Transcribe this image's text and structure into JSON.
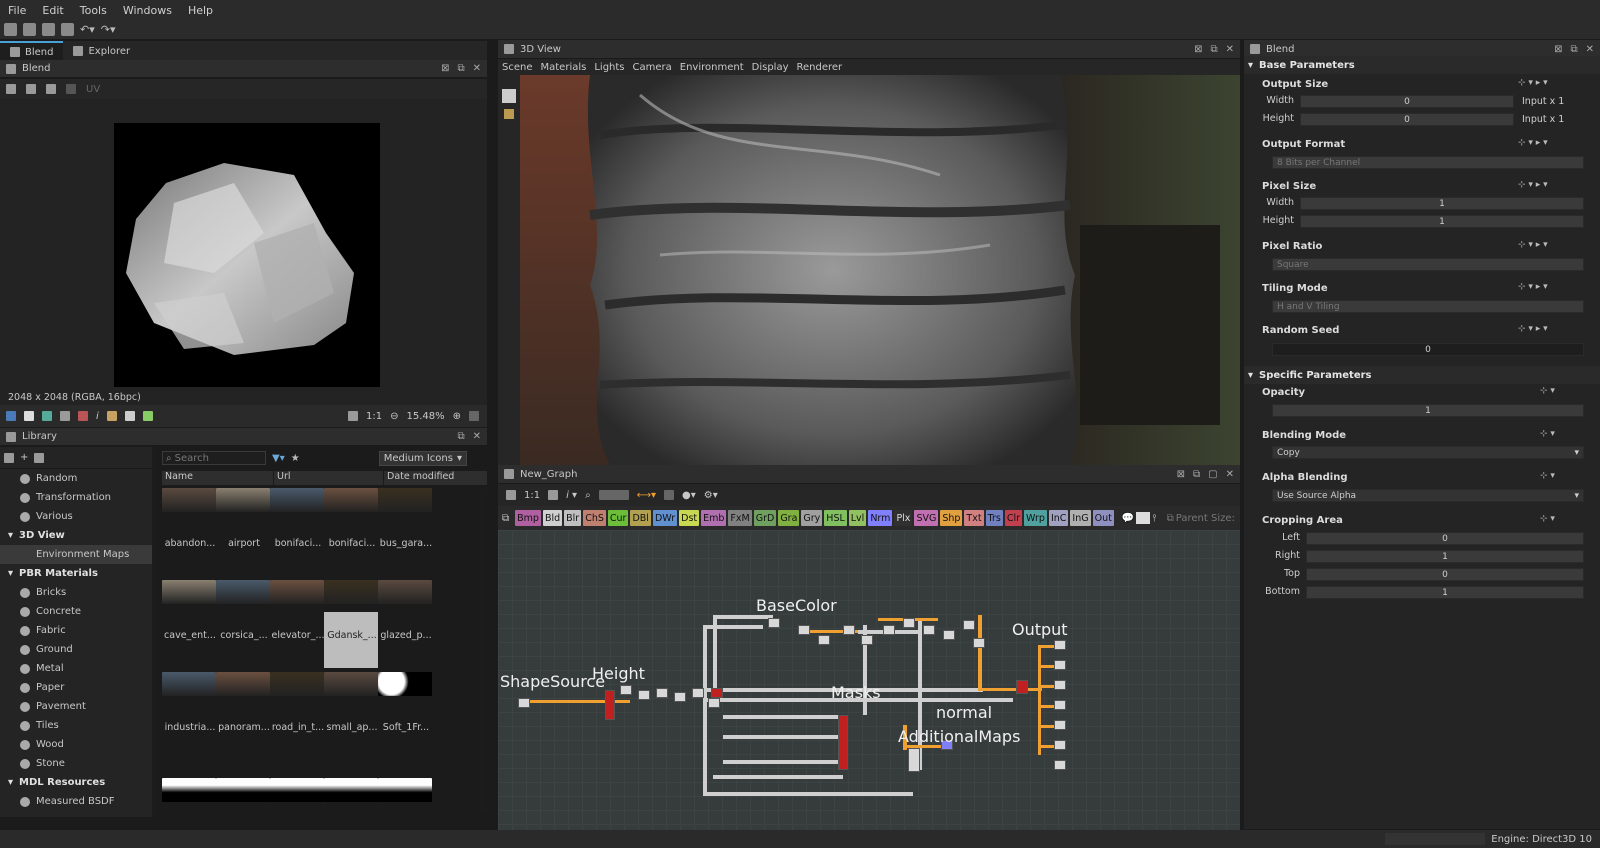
{
  "menu": {
    "items": [
      "File",
      "Edit",
      "Tools",
      "Windows",
      "Help"
    ]
  },
  "left_tabs": {
    "blend": "Blend",
    "explorer": "Explorer"
  },
  "view2d": {
    "title": "Blend",
    "uv_label": "UV",
    "info": "2048 x 2048 (RGBA, 16bpc)",
    "zoom_ratio": "1:1",
    "zoom": "15.48%"
  },
  "library": {
    "title": "Library",
    "search_placeholder": "Search",
    "view_mode": "Medium Icons",
    "columns": [
      "Name",
      "Url",
      "Date modified"
    ],
    "tree": [
      {
        "label": "Random",
        "kind": "item"
      },
      {
        "label": "Transformation",
        "kind": "item"
      },
      {
        "label": "Various",
        "kind": "item"
      },
      {
        "label": "3D View",
        "kind": "cat"
      },
      {
        "label": "Environment Maps",
        "kind": "selected"
      },
      {
        "label": "PBR Materials",
        "kind": "cat"
      },
      {
        "label": "Bricks",
        "kind": "item"
      },
      {
        "label": "Concrete",
        "kind": "item"
      },
      {
        "label": "Fabric",
        "kind": "item"
      },
      {
        "label": "Ground",
        "kind": "item"
      },
      {
        "label": "Metal",
        "kind": "item"
      },
      {
        "label": "Paper",
        "kind": "item"
      },
      {
        "label": "Pavement",
        "kind": "item"
      },
      {
        "label": "Tiles",
        "kind": "item"
      },
      {
        "label": "Wood",
        "kind": "item"
      },
      {
        "label": "Stone",
        "kind": "item"
      },
      {
        "label": "MDL Resources",
        "kind": "cat"
      },
      {
        "label": "Measured BSDF",
        "kind": "item"
      }
    ],
    "thumbs": [
      [
        "abandon...",
        "airport",
        "bonifaci...",
        "bonifaci...",
        "bus_gara..."
      ],
      [
        "cave_ent...",
        "corsica_...",
        "elevator_...",
        "Gdansk_...",
        "glazed_p..."
      ],
      [
        "industria...",
        "panoram...",
        "road_in_t...",
        "small_ap...",
        "Soft_1Fr..."
      ]
    ]
  },
  "view3d": {
    "title": "3D View",
    "menu": [
      "Scene",
      "Materials",
      "Lights",
      "Camera",
      "Environment",
      "Display",
      "Renderer"
    ]
  },
  "graph": {
    "title": "New_Graph",
    "zoom_ratio": "1:1",
    "node_tags": [
      {
        "t": "Bmp",
        "c": "#b060a0"
      },
      {
        "t": "Bld",
        "c": "#d0d0d0"
      },
      {
        "t": "Blr",
        "c": "#c0c0c0"
      },
      {
        "t": "ChS",
        "c": "#c08070"
      },
      {
        "t": "Cur",
        "c": "#6cbe3a"
      },
      {
        "t": "DBl",
        "c": "#b0a050"
      },
      {
        "t": "DWr",
        "c": "#6090d0"
      },
      {
        "t": "Dst",
        "c": "#c8d850"
      },
      {
        "t": "Emb",
        "c": "#b070b0"
      },
      {
        "t": "FxM",
        "c": "#808080"
      },
      {
        "t": "GrD",
        "c": "#70a060"
      },
      {
        "t": "Gra",
        "c": "#80b040"
      },
      {
        "t": "Gry",
        "c": "#a0a0a0"
      },
      {
        "t": "HSL",
        "c": "#80c060"
      },
      {
        "t": "Lvl",
        "c": "#90c060"
      },
      {
        "t": "Nrm",
        "c": "#8080ff"
      },
      {
        "t": "Plx",
        "c": "#303030"
      },
      {
        "t": "SVG",
        "c": "#c070b0"
      },
      {
        "t": "Shp",
        "c": "#e0a040"
      },
      {
        "t": "Txt",
        "c": "#d08080"
      },
      {
        "t": "Trs",
        "c": "#7080c0"
      },
      {
        "t": "Clr",
        "c": "#c04050"
      },
      {
        "t": "Wrp",
        "c": "#50a0a0"
      },
      {
        "t": "InC",
        "c": "#a0a0c0"
      },
      {
        "t": "InG",
        "c": "#b0b0b0"
      },
      {
        "t": "Out",
        "c": "#9090c0"
      }
    ],
    "parent_size": "Parent Size:",
    "labels": {
      "shape_source": "ShapeSource",
      "height": "Height",
      "base_color": "BaseColor",
      "masks": "Masks",
      "normal": "normal",
      "additional_maps": "AdditionalMaps",
      "output": "Output"
    }
  },
  "params": {
    "title": "Blend",
    "base_section": "Base Parameters",
    "specific_section": "Specific Parameters",
    "output_size": {
      "label": "Output Size",
      "width_label": "Width",
      "width_value": "0",
      "width_suffix": "Input x 1",
      "height_label": "Height",
      "height_value": "0",
      "height_suffix": "Input x 1"
    },
    "output_format": {
      "label": "Output Format",
      "value": "8 Bits per Channel"
    },
    "pixel_size": {
      "label": "Pixel Size",
      "width_label": "Width",
      "width_value": "1",
      "height_label": "Height",
      "height_value": "1"
    },
    "pixel_ratio": {
      "label": "Pixel Ratio",
      "value": "Square"
    },
    "tiling_mode": {
      "label": "Tiling Mode",
      "value": "H and V Tiling"
    },
    "random_seed": {
      "label": "Random Seed",
      "value": "0"
    },
    "opacity": {
      "label": "Opacity",
      "value": "1"
    },
    "blending_mode": {
      "label": "Blending Mode",
      "value": "Copy"
    },
    "alpha_blending": {
      "label": "Alpha Blending",
      "value": "Use Source Alpha"
    },
    "cropping": {
      "label": "Cropping Area",
      "left_label": "Left",
      "left_value": "0",
      "right_label": "Right",
      "right_value": "1",
      "top_label": "Top",
      "top_value": "0",
      "bottom_label": "Bottom",
      "bottom_value": "1"
    }
  },
  "status": {
    "engine": "Engine: Direct3D 10"
  },
  "colors": {
    "accent": "#4aa0d8",
    "orange_wire": "#f0a030",
    "panel": "#2d2d2d"
  }
}
